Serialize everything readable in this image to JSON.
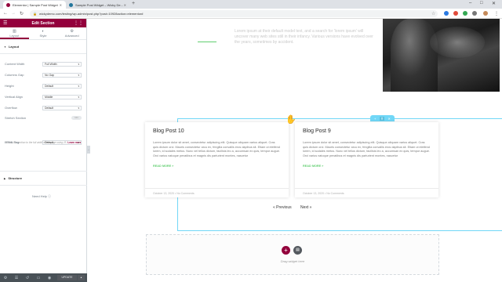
{
  "browser": {
    "tabs": [
      {
        "title": "Elementor | Sample Post Widget",
        "active": true
      },
      {
        "title": "Sample Post Widget – Wicky De...",
        "active": false
      }
    ],
    "url": "wickydemo.com/testing/wp-admin/post.php?post=10928action=elementor#"
  },
  "panel": {
    "title": "Edit Section",
    "tabs": [
      {
        "label": "Layout",
        "icon": "layout-icon"
      },
      {
        "label": "Style",
        "icon": "style-icon"
      },
      {
        "label": "Advanced",
        "icon": "gear-icon"
      }
    ],
    "section_layout": "Layout",
    "controls": [
      {
        "label": "Content Width",
        "value": "Full Width"
      },
      {
        "label": "Columns Gap",
        "value": "No Gap"
      },
      {
        "label": "Height",
        "value": "Default"
      },
      {
        "label": "Vertical Align",
        "value": "Middle"
      },
      {
        "label": "Overflow",
        "value": "Default"
      }
    ],
    "stretch": {
      "label": "Stretch Section",
      "toggle": "NO"
    },
    "stretch_desc": "Stretch the section to the full width of the page using JS.",
    "stretch_link": "Learn more",
    "html_tag": {
      "label": "HTML Tag",
      "value": "Default"
    },
    "section_structure": "Structure",
    "need_help": "Need Help",
    "update": "UPDATE"
  },
  "preview": {
    "faded_text": "Lorem ipsum at their default model text, and a search for 'lorem ipsum' will uncover many web sites still in their infancy. Various versions have evolved over the years, sometimes by accident.",
    "posts": [
      {
        "title": "Blog Post 10",
        "excerpt": "Lorem ipsum dolor sit amet, consectetur adipiscing elit. Quisque aliquam varius aliquet. Cras quis dictum orci. Mauris consectetur arcu ex, fringilla convallis eros dapibus sit. Etiam ut eleifend lorem, id sodales metus. Nunc vel tellus dictum, facilisis leo a, accumsan ex quis, tempor augue. Orci varius natoque penatibus et magnis dis parturient montes, nascetur",
        "read_more": "READ MORE »",
        "meta": "October 13, 2020  •  No Comments"
      },
      {
        "title": "Blog Post 9",
        "excerpt": "Lorem ipsum dolor sit amet, consectetur adipiscing elit. Quisque aliquam varius aliquet. Cras quis dictum orci. Mauris consectetur arcu ex, fringilla convallis eros dapibus sit. Etiam ut eleifend lorem, id sodales metus. Nunc vel tellus dictum, facilisis leo a, accumsan ex quis, tempor augue. Orci varius natoque penatibus et magnis dis parturient montes, nascetur",
        "read_more": "READ MORE »",
        "meta": "October 13, 2020  •  No Comments"
      }
    ],
    "pagination": {
      "prev": "« Previous",
      "next": "Next »"
    },
    "drag_widget": "Drag widget here"
  },
  "colors": {
    "brand": "#93003c",
    "accent_green": "#61ce70",
    "section_outline": "#71d7f7"
  }
}
